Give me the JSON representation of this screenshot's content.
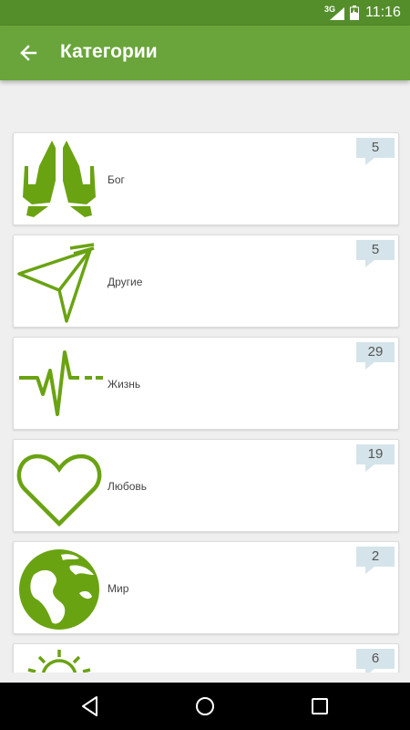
{
  "status_bar": {
    "network": "3G",
    "time": "11:16"
  },
  "app_bar": {
    "title": "Категории"
  },
  "categories": [
    {
      "label": "Бог",
      "count": "5",
      "icon": "praying-hands-icon"
    },
    {
      "label": "Другие",
      "count": "5",
      "icon": "paper-plane-icon"
    },
    {
      "label": "Жизнь",
      "count": "29",
      "icon": "heartbeat-icon"
    },
    {
      "label": "Любовь",
      "count": "19",
      "icon": "heart-icon"
    },
    {
      "label": "Мир",
      "count": "2",
      "icon": "globe-icon"
    },
    {
      "label": "",
      "count": "6",
      "icon": "sun-icon"
    }
  ],
  "colors": {
    "accent": "#69a53a",
    "status_bar": "#548e2a",
    "icon": "#6aa312",
    "badge": "#d5e4ea"
  }
}
